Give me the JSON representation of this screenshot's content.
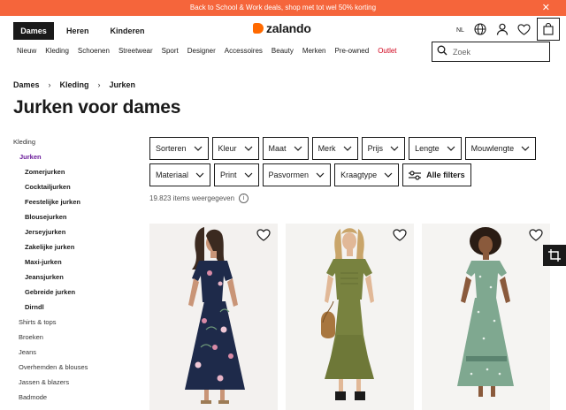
{
  "promo": {
    "text": "Back to School & Work deals, shop met tot wel 50% korting"
  },
  "header": {
    "gender_tabs": [
      "Dames",
      "Heren",
      "Kinderen"
    ],
    "logo_text": "zalando",
    "language": "NL"
  },
  "nav": {
    "items": [
      "Nieuw",
      "Kleding",
      "Schoenen",
      "Streetwear",
      "Sport",
      "Designer",
      "Accessoires",
      "Beauty",
      "Merken",
      "Pre-owned",
      "Outlet"
    ]
  },
  "search": {
    "placeholder": "Zoek"
  },
  "breadcrumb": [
    "Dames",
    "Kleding",
    "Jurken"
  ],
  "page_title": "Jurken voor dames",
  "sidebar": {
    "top": "Kleding",
    "active": "Jurken",
    "sub": [
      "Zomerjurken",
      "Cocktailjurken",
      "Feestelijke jurken",
      "Blousejurken",
      "Jerseyjurken",
      "Zakelijke jurken",
      "Maxi-jurken",
      "Jeansjurken",
      "Gebreide jurken",
      "Dirndl"
    ],
    "categories": [
      "Shirts & tops",
      "Broeken",
      "Jeans",
      "Overhemden & blouses",
      "Jassen & blazers",
      "Badmode"
    ]
  },
  "filters": {
    "row1": [
      "Sorteren",
      "Kleur",
      "Maat",
      "Merk",
      "Prijs",
      "Lengte",
      "Mouwlengte"
    ],
    "row2": [
      "Materiaal",
      "Print",
      "Pasvormen",
      "Kraagtype"
    ],
    "all_filters": "Alle filters"
  },
  "results": {
    "count_text": "19.823 items weergegeven",
    "info_glyph": "i"
  },
  "colors": {
    "accent": "#f5653b",
    "brand": "#ff6900",
    "active_link": "#6a1b9a",
    "sale": "#d0021b"
  }
}
